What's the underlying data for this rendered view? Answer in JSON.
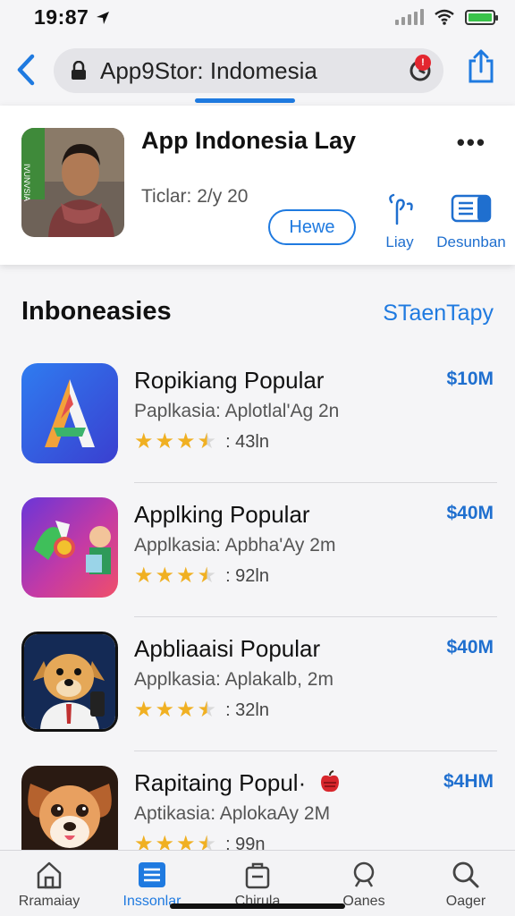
{
  "status": {
    "time": "19:87"
  },
  "address_bar": {
    "url": "App9Stor: Indomesia",
    "badge": "!"
  },
  "app": {
    "name": "App Indonesia Lay",
    "subtitle": "Ticlar: 2/y 20",
    "avatar_tag": "IVUNVSIA",
    "view_button": "Hewe",
    "actions": [
      {
        "label": "Liay",
        "icon": "gesture-icon"
      },
      {
        "label": "Desunban",
        "icon": "card-icon"
      }
    ]
  },
  "section": {
    "title": "Inboneasies",
    "link": "STaenTapy"
  },
  "list": [
    {
      "title": "Ropikiang Popular",
      "subtitle": "Paplkasia: Aplotlal'Ag 2n",
      "rating": 3.5,
      "count": ": 43ln",
      "price": "$10M",
      "icon": "letter-a-app-icon"
    },
    {
      "title": "Applking Popular",
      "subtitle": "Applkasia: Apbha'Ay 2m",
      "rating": 3.5,
      "count": ": 92ln",
      "price": "$40M",
      "icon": "character-collage-app-icon"
    },
    {
      "title": "Apbliaaisi Popular",
      "subtitle": "Applkasia: Aplakalb, 2m",
      "rating": 3.5,
      "count": ": 32ln",
      "price": "$40M",
      "icon": "cartoon-dog-phone-app-icon"
    },
    {
      "title": "Rapitaing Popul·",
      "subtitle": "Aptikasia: AplokaAy 2M",
      "rating": 3.5,
      "count": ": 99n",
      "price": "$4HM",
      "icon": "puppy-app-icon"
    }
  ],
  "tabs": [
    {
      "label": "Rramaiay",
      "icon": "home-icon",
      "active": false
    },
    {
      "label": "Inssonlar",
      "icon": "list-icon",
      "active": true
    },
    {
      "label": "Chirula",
      "icon": "bag-icon",
      "active": false
    },
    {
      "label": "Oanes",
      "icon": "rocket-icon",
      "active": false
    },
    {
      "label": "Oager",
      "icon": "search-icon",
      "active": false
    }
  ],
  "colors": {
    "accent": "#1f7ae0",
    "star": "#f0b022",
    "badge": "#e3262f"
  }
}
